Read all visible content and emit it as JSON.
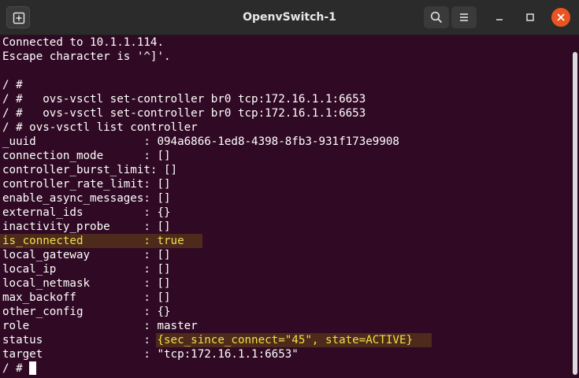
{
  "window": {
    "title": "OpenvSwitch-1",
    "accent": "#e95420",
    "background": "#300a24"
  },
  "terminal": {
    "lines": [
      "Connected to 10.1.1.114.",
      "Escape character is '^]'.",
      "",
      "/ #",
      "/ #   ovs-vsctl set-controller br0 tcp:172.16.1.1:6653",
      "/ #   ovs-vsctl set-controller br0 tcp:172.16.1.1:6653",
      "/ # ovs-vsctl list controller",
      "_uuid                : 094a6866-1ed8-4398-8fb3-931f173e9908",
      "connection_mode      : []",
      "controller_burst_limit: []",
      "controller_rate_limit: []",
      "enable_async_messages: []",
      "external_ids         : {}",
      "inactivity_probe     : []",
      "is_connected         : true",
      "local_gateway        : []",
      "local_ip             : []",
      "local_netmask        : []",
      "max_backoff          : []",
      "other_config         : {}",
      "role                 : master",
      "status               : {sec_since_connect=\"45\", state=ACTIVE}",
      "target               : \"tcp:172.16.1.1:6653\""
    ],
    "prompt": "/ # ",
    "highlight_color": "#f0e04a"
  }
}
